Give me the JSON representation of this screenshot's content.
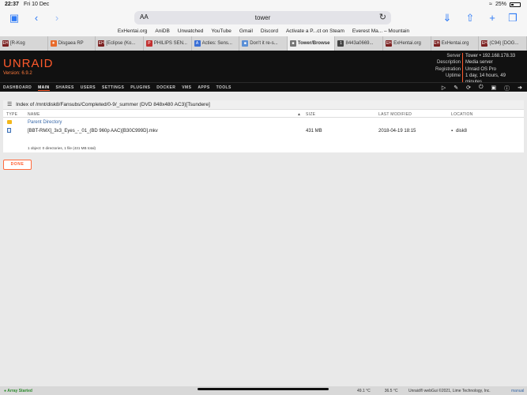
{
  "status_bar": {
    "time": "22:37",
    "date": "Fri 10 Dec",
    "battery": "25%"
  },
  "address_bar": {
    "aa_label": "AA",
    "host": "tower"
  },
  "favorites": [
    "ExHentai.org",
    "AniDB",
    "Unwatched",
    "YouTube",
    "Gmail",
    "Discord",
    "Activate a P...ct on Steam",
    "Everest Ma... – Mountain"
  ],
  "tabs": [
    {
      "label": "[R-Kog",
      "icon": "EH",
      "color": "#7a1f1f"
    },
    {
      "label": "Disgaea RP",
      "icon": "✷",
      "color": "#e86a2a"
    },
    {
      "label": "[Eclipse (Ko...",
      "icon": "EH",
      "color": "#7a1f1f"
    },
    {
      "label": "PHILIPS SEN...",
      "icon": "P",
      "color": "#c23030"
    },
    {
      "label": "Acties: Sens...",
      "icon": "A",
      "color": "#3a6fd6"
    },
    {
      "label": "Don't it re-s...",
      "icon": "■",
      "color": "#5a8fd6"
    },
    {
      "label": "Tower/Browse",
      "icon": "■",
      "color": "#777777",
      "active": true
    },
    {
      "label": "8443a0669...",
      "icon": "1",
      "color": "#444444"
    },
    {
      "label": "ExHentai.org",
      "icon": "EH",
      "color": "#7a1f1f"
    },
    {
      "label": "ExHentai.org",
      "icon": "EH",
      "color": "#7a1f1f"
    },
    {
      "label": "(C94) [DOG...",
      "icon": "EH",
      "color": "#7a1f1f"
    }
  ],
  "header": {
    "logo": "UNRAID",
    "version": "Version: 6.9.2",
    "info": [
      {
        "key": "Server",
        "value": "Tower • 192.168.178.33"
      },
      {
        "key": "Description",
        "value": "Media server"
      },
      {
        "key": "Registration",
        "value": "Unraid OS Pro"
      },
      {
        "key": "Uptime",
        "value": "1 day, 14 hours, 49 minutes"
      }
    ]
  },
  "nav": [
    "DASHBOARD",
    "MAIN",
    "SHARES",
    "USERS",
    "SETTINGS",
    "PLUGINS",
    "DOCKER",
    "VMS",
    "APPS",
    "TOOLS"
  ],
  "nav_current": "MAIN",
  "browser": {
    "title": "Index of /mnt/disk8/Fansubs/Completed/0-9/_summer (DVD 848x480 AC3)[Tsundere]",
    "columns": {
      "type": "TYPE",
      "name": "NAME",
      "size": "SIZE",
      "modified": "LAST MODIFIED",
      "location": "LOCATION"
    },
    "parent_label": "Parent Directory",
    "file": {
      "name": "[BBT-RMX]_3x3_Eyes_-_01_(BD 960p AAC)[B30C999D].mkv",
      "size": "431 MB",
      "modified": "2018-04-19 18:15",
      "location": "disk8"
    },
    "summary": "1 object: 0 directories, 1 file (431 MB total)"
  },
  "done_label": "DONE",
  "footer": {
    "status": "Array Started",
    "temp1": "49.1 °C",
    "temp2": "36.5 °C",
    "copyright": "Unraid® webGui ©2021, Lime Technology, Inc.",
    "manual": "manual"
  }
}
